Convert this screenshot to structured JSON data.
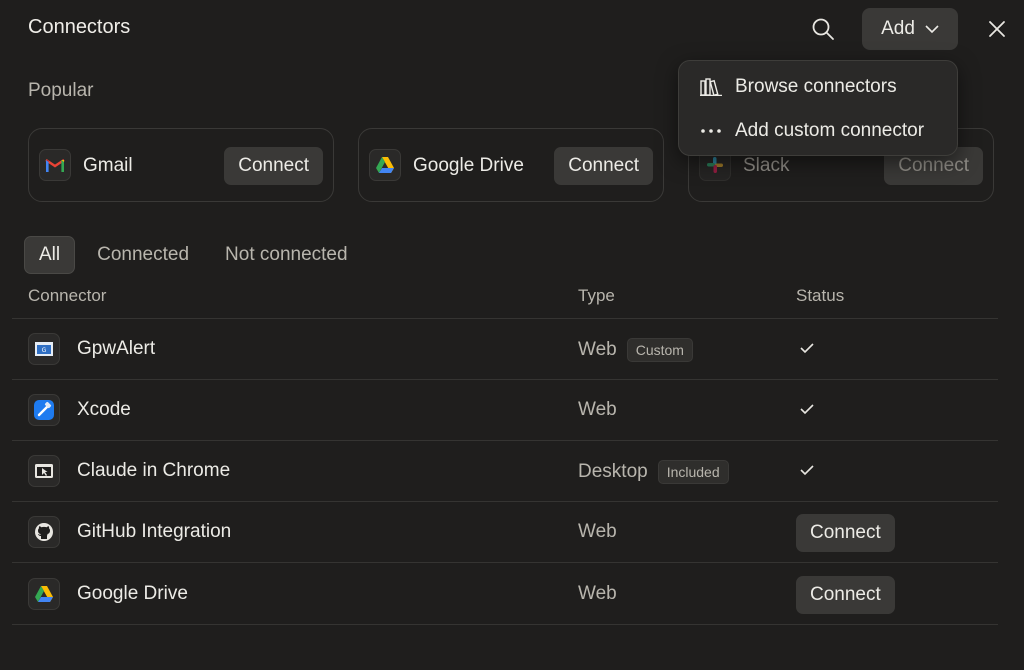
{
  "header": {
    "title": "Connectors",
    "add_label": "Add"
  },
  "popular": {
    "label": "Popular",
    "cards": [
      {
        "name": "Gmail",
        "action": "Connect"
      },
      {
        "name": "Google Drive",
        "action": "Connect"
      },
      {
        "name": "Slack",
        "action": "Connect"
      }
    ]
  },
  "filters": [
    "All",
    "Connected",
    "Not connected"
  ],
  "table": {
    "headers": [
      "Connector",
      "Type",
      "Status"
    ],
    "rows": [
      {
        "name": "GpwAlert",
        "type": "Web",
        "badge": "Custom",
        "status": "connected"
      },
      {
        "name": "Xcode",
        "type": "Web",
        "badge": "",
        "status": "connected"
      },
      {
        "name": "Claude in Chrome",
        "type": "Desktop",
        "badge": "Included",
        "status": "connected"
      },
      {
        "name": "GitHub Integration",
        "type": "Web",
        "badge": "",
        "action": "Connect"
      },
      {
        "name": "Google Drive",
        "type": "Web",
        "badge": "",
        "action": "Connect"
      }
    ]
  },
  "add_menu": {
    "items": [
      {
        "label": "Browse connectors",
        "icon": "books-icon"
      },
      {
        "label": "Add custom connector",
        "icon": "ellipsis-icon"
      }
    ]
  },
  "colors": {
    "background": "#1f1e1d",
    "button": "#3a3937",
    "text": "#ecebe6",
    "muted": "#b8b5ad"
  }
}
